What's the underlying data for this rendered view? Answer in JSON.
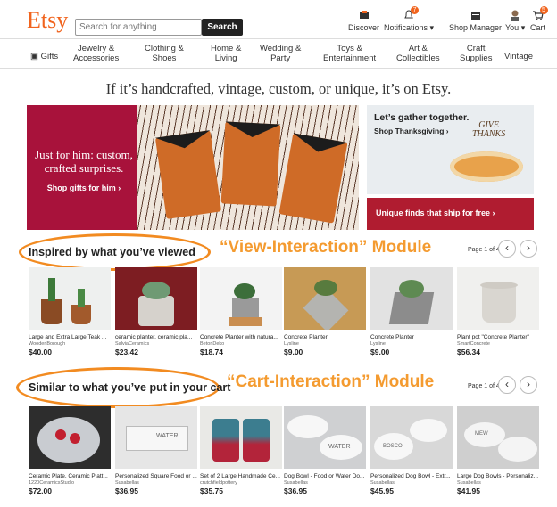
{
  "header": {
    "logo": "Etsy",
    "search_placeholder": "Search for anything",
    "search_button": "Search",
    "discover": "Discover",
    "notifications": "Notifications",
    "notifications_count": "7",
    "shop_manager": "Shop Manager",
    "you": "You",
    "cart": "Cart",
    "cart_count": "5"
  },
  "nav": [
    {
      "label": "Gifts"
    },
    {
      "label": "Jewelry &",
      "label2": "Accessories"
    },
    {
      "label": "Clothing &",
      "label2": "Shoes"
    },
    {
      "label": "Home &",
      "label2": "Living"
    },
    {
      "label": "Wedding &",
      "label2": "Party"
    },
    {
      "label": "Toys &",
      "label2": "Entertainment"
    },
    {
      "label": "Art &",
      "label2": "Collectibles"
    },
    {
      "label": "Craft",
      "label2": "Supplies"
    },
    {
      "label": "Vintage"
    }
  ],
  "hero": {
    "tagline": "If it’s handcrafted, vintage, custom, or unique, it’s on Etsy.",
    "left_title_1": "Just for him: custom,",
    "left_title_2": "crafted surprises.",
    "left_link": "Shop gifts for him ›",
    "right_title": "Let’s gather together.",
    "right_link": "Shop Thanksgiving ›",
    "cake_topper_1": "GIVE",
    "cake_topper_2": "THANKS",
    "free_ship": "Unique finds that ship for free ›"
  },
  "modules": [
    {
      "title": "Inspired by what you’ve viewed",
      "annotation": "“View-Interaction” Module",
      "pager": "Page 1 of 4",
      "items": [
        {
          "name": "Large and Extra Large Teak ...",
          "shop": "WoodenBorough",
          "price": "$40.00"
        },
        {
          "name": "ceramic planter, ceramic pla...",
          "shop": "SalviaCeramics",
          "price": "$23.42"
        },
        {
          "name": "Concrete Planter with natura...",
          "shop": "BetonDeko",
          "price": "$18.74"
        },
        {
          "name": "Concrete Planter",
          "shop": "Lysline",
          "price": "$9.00"
        },
        {
          "name": "Concrete Planter",
          "shop": "Lysline",
          "price": "$9.00"
        },
        {
          "name": "Plant pot \"Concrete Planter\"",
          "shop": "SmartConcrete",
          "price": "$56.34"
        }
      ]
    },
    {
      "title": "Similar to what you’ve put in your cart",
      "annotation": "“Cart-Interaction” Module",
      "pager": "Page 1 of 4",
      "items": [
        {
          "name": "Ceramic Plate, Ceramic Platt...",
          "shop": "1220CeramicsStudio",
          "price": "$72.00",
          "img_text": ""
        },
        {
          "name": "Personalized Square Food or ...",
          "shop": "Susabellas",
          "price": "$36.95",
          "img_text": "WATER"
        },
        {
          "name": "Set of 2 Large Handmade Ce...",
          "shop": "crutchfieldpottery",
          "price": "$35.75",
          "img_text": ""
        },
        {
          "name": "Dog Bowl - Food or Water Do...",
          "shop": "Susabellas",
          "price": "$36.95",
          "img_text": "WATER"
        },
        {
          "name": "Personalized Dog Bowl - Extr...",
          "shop": "Susabellas",
          "price": "$45.95",
          "img_text": "BOSCO"
        },
        {
          "name": "Large Dog Bowls - Personaliz...",
          "shop": "Susabellas",
          "price": "$41.95",
          "img_text": "MEW"
        }
      ]
    }
  ]
}
